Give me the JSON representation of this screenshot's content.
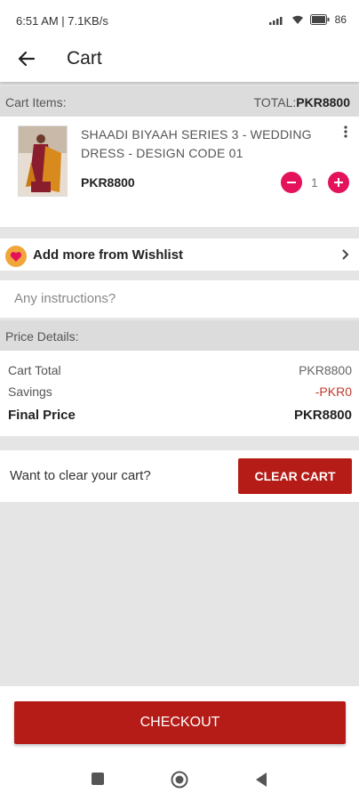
{
  "status_bar": {
    "time": "6:51 AM | 7.1KB/s",
    "battery": "86"
  },
  "app_bar": {
    "title": "Cart",
    "back_icon": "arrow-left-icon"
  },
  "cart_header": {
    "label": "Cart Items:",
    "total_label": "TOTAL:",
    "total_value": "PKR8800"
  },
  "cart_items": [
    {
      "name": "SHAADI BIYAAH SERIES 3 - WEDDING DRESS - DESIGN CODE 01",
      "price": "PKR8800",
      "quantity": "1"
    }
  ],
  "wishlist": {
    "label": "Add more from Wishlist",
    "icon": "heart-icon"
  },
  "instructions": {
    "placeholder": "Any instructions?"
  },
  "price_details": {
    "header": "Price Details:",
    "cart_total_label": "Cart Total",
    "cart_total_value": "PKR8800",
    "savings_label": "Savings",
    "savings_value": "-PKR0",
    "final_label": "Final Price",
    "final_value": "PKR8800"
  },
  "clear_cart": {
    "question": "Want to clear your cart?",
    "button_label": "CLEAR CART"
  },
  "checkout": {
    "button_label": "CHECKOUT"
  },
  "colors": {
    "primary": "#b51b17",
    "qty_button": "#e3125b",
    "wishlist_icon_bg": "#f0a63a",
    "savings_text": "#c0392b"
  }
}
